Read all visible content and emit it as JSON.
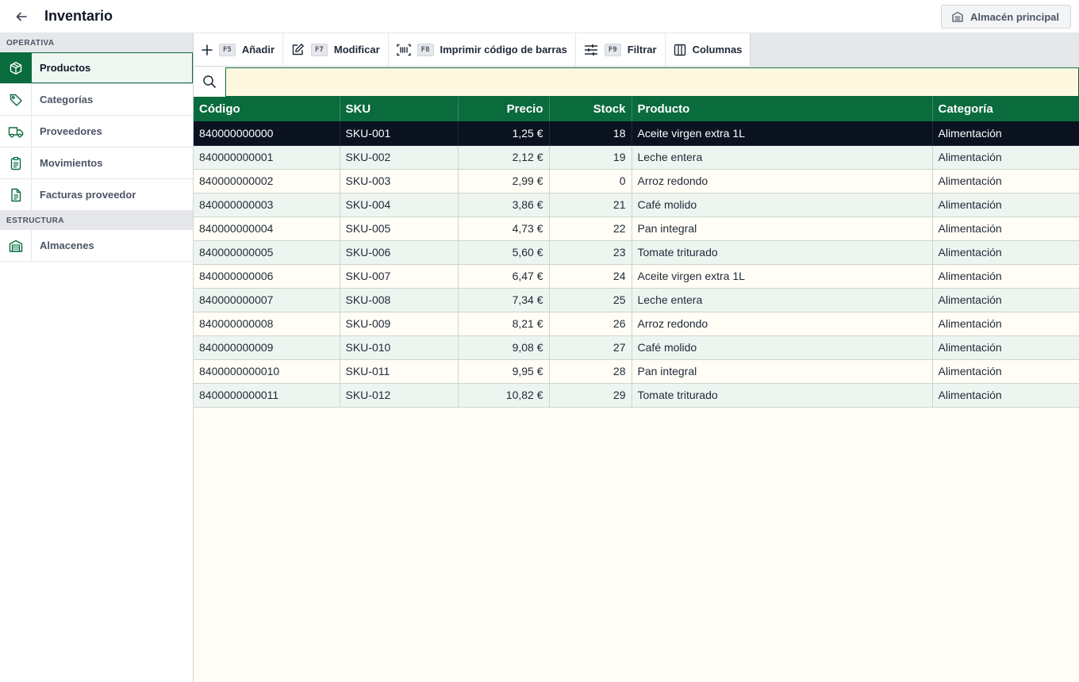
{
  "header": {
    "title": "Inventario",
    "warehouse_label": "Almacén principal"
  },
  "sidebar": {
    "sections": [
      {
        "title": "OPERATIVA",
        "items": [
          {
            "label": "Productos",
            "icon": "box-icon",
            "active": true
          },
          {
            "label": "Categorías",
            "icon": "tag-icon",
            "active": false
          },
          {
            "label": "Proveedores",
            "icon": "truck-icon",
            "active": false
          },
          {
            "label": "Movimientos",
            "icon": "clipboard-icon",
            "active": false
          },
          {
            "label": "Facturas proveedor",
            "icon": "document-icon",
            "active": false
          }
        ]
      },
      {
        "title": "ESTRUCTURA",
        "items": [
          {
            "label": "Almacenes",
            "icon": "warehouse-icon",
            "active": false
          }
        ]
      }
    ]
  },
  "toolbar": {
    "add": {
      "key": "F5",
      "label": "Añadir",
      "icon": "plus-icon"
    },
    "edit": {
      "key": "F7",
      "label": "Modificar",
      "icon": "edit-icon"
    },
    "barcode": {
      "key": "F8",
      "label": "Imprimir código de barras",
      "icon": "barcode-icon"
    },
    "filter": {
      "key": "F9",
      "label": "Filtrar",
      "icon": "sliders-icon"
    },
    "columns": {
      "label": "Columnas",
      "icon": "columns-icon"
    }
  },
  "search": {
    "value": "",
    "placeholder": ""
  },
  "table": {
    "columns": [
      "Código",
      "SKU",
      "Precio",
      "Stock",
      "Producto",
      "Categoría"
    ],
    "selected_row": 0,
    "rows": [
      [
        "840000000000",
        "SKU-001",
        "1,25 €",
        "18",
        "Aceite virgen extra 1L",
        "Alimentación"
      ],
      [
        "840000000001",
        "SKU-002",
        "2,12 €",
        "19",
        "Leche entera",
        "Alimentación"
      ],
      [
        "840000000002",
        "SKU-003",
        "2,99 €",
        "0",
        "Arroz redondo",
        "Alimentación"
      ],
      [
        "840000000003",
        "SKU-004",
        "3,86 €",
        "21",
        "Café molido",
        "Alimentación"
      ],
      [
        "840000000004",
        "SKU-005",
        "4,73 €",
        "22",
        "Pan integral",
        "Alimentación"
      ],
      [
        "840000000005",
        "SKU-006",
        "5,60 €",
        "23",
        "Tomate triturado",
        "Alimentación"
      ],
      [
        "840000000006",
        "SKU-007",
        "6,47 €",
        "24",
        "Aceite virgen extra 1L",
        "Alimentación"
      ],
      [
        "840000000007",
        "SKU-008",
        "7,34 €",
        "25",
        "Leche entera",
        "Alimentación"
      ],
      [
        "840000000008",
        "SKU-009",
        "8,21 €",
        "26",
        "Arroz redondo",
        "Alimentación"
      ],
      [
        "840000000009",
        "SKU-010",
        "9,08 €",
        "27",
        "Café molido",
        "Alimentación"
      ],
      [
        "8400000000010",
        "SKU-011",
        "9,95 €",
        "28",
        "Pan integral",
        "Alimentación"
      ],
      [
        "8400000000011",
        "SKU-012",
        "10,82 €",
        "29",
        "Tomate triturado",
        "Alimentación"
      ]
    ]
  },
  "colors": {
    "accent": "#0a6b3d",
    "selected_row": "#0b1220",
    "search_bg": "#fff8e1"
  }
}
